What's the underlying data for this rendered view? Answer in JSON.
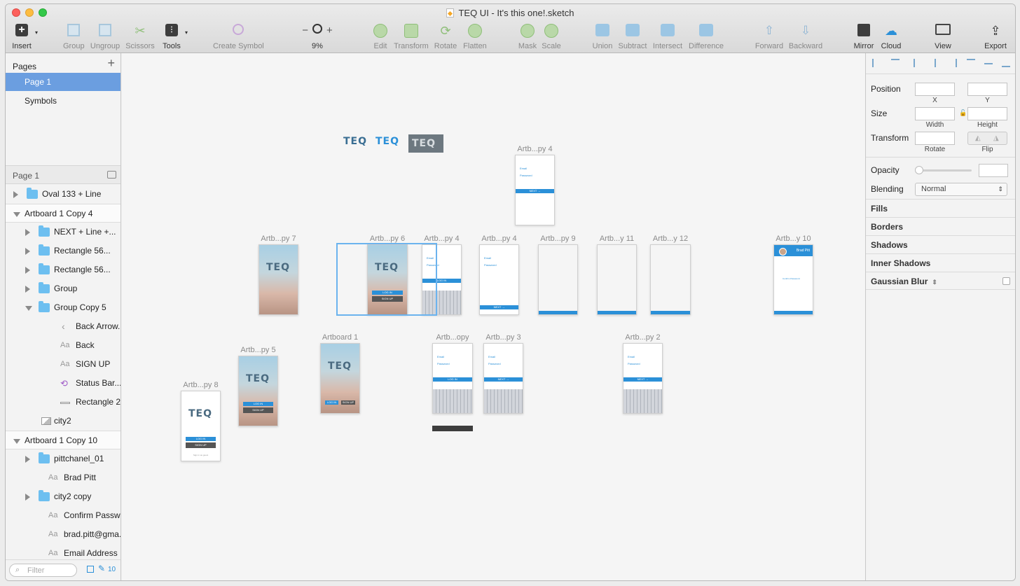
{
  "window": {
    "title": "TEQ UI - It's this one!.sketch"
  },
  "toolbar": {
    "insert": "Insert",
    "group": "Group",
    "ungroup": "Ungroup",
    "scissors": "Scissors",
    "tools": "Tools",
    "create_symbol": "Create Symbol",
    "zoom": "9%",
    "zoom_minus": "−",
    "zoom_plus": "+",
    "edit": "Edit",
    "transform": "Transform",
    "rotate": "Rotate",
    "flatten": "Flatten",
    "mask": "Mask",
    "scale": "Scale",
    "union": "Union",
    "subtract": "Subtract",
    "intersect": "Intersect",
    "difference": "Difference",
    "forward": "Forward",
    "backward": "Backward",
    "mirror": "Mirror",
    "cloud": "Cloud",
    "view": "View",
    "export": "Export"
  },
  "pages": {
    "header": "Pages",
    "add": "+",
    "items": [
      "Page 1",
      "Symbols"
    ],
    "selected": "Page 1"
  },
  "layers": {
    "page_header": "Page 1",
    "items": [
      {
        "name": "Oval 133 + Line",
        "type": "folder",
        "indent": 0,
        "collapsed": true
      },
      {
        "name": "Artboard 1 Copy 4",
        "type": "artboard",
        "indent": 0
      },
      {
        "name": "NEXT + Line +...",
        "type": "folder",
        "indent": 1,
        "collapsed": true
      },
      {
        "name": "Rectangle 56...",
        "type": "folder",
        "indent": 1,
        "collapsed": true
      },
      {
        "name": "Rectangle 56...",
        "type": "folder",
        "indent": 1,
        "collapsed": true
      },
      {
        "name": "Group",
        "type": "folder",
        "indent": 1,
        "collapsed": true
      },
      {
        "name": "Group Copy 5",
        "type": "folder",
        "indent": 1,
        "collapsed": false
      },
      {
        "name": "Back Arrow...",
        "type": "shape",
        "indent": 2
      },
      {
        "name": "Back",
        "type": "text",
        "indent": 2
      },
      {
        "name": "SIGN UP",
        "type": "text",
        "indent": 2
      },
      {
        "name": "Status Bar...",
        "type": "symbol",
        "indent": 2
      },
      {
        "name": "Rectangle 2...",
        "type": "rect",
        "indent": 2
      },
      {
        "name": "city2",
        "type": "image",
        "indent": 1
      },
      {
        "name": "Artboard 1 Copy 10",
        "type": "artboard",
        "indent": 0
      },
      {
        "name": "pittchanel_01",
        "type": "folder",
        "indent": 1,
        "collapsed": true
      },
      {
        "name": "Brad Pitt",
        "type": "text",
        "indent": 1
      },
      {
        "name": "city2 copy",
        "type": "folder",
        "indent": 1,
        "collapsed": true
      },
      {
        "name": "Confirm Passw...",
        "type": "text",
        "indent": 1
      },
      {
        "name": "brad.pitt@gma...",
        "type": "text",
        "indent": 1
      },
      {
        "name": "Email Address",
        "type": "text",
        "indent": 1
      }
    ],
    "filter_placeholder": "Filter",
    "count": "10"
  },
  "canvas": {
    "artboards": [
      {
        "label": "Artb...py 4",
        "kind": "signup-top"
      },
      {
        "label": "Artb...py 7",
        "kind": "city"
      },
      {
        "label": "Artb...py 6",
        "kind": "city-login"
      },
      {
        "label": "Artb...py 4",
        "kind": "login-kbd"
      },
      {
        "label": "Artb...py 4",
        "kind": "form"
      },
      {
        "label": "Artb...py 9",
        "kind": "map"
      },
      {
        "label": "Artb...y 11",
        "kind": "map"
      },
      {
        "label": "Artb...y 12",
        "kind": "map"
      },
      {
        "label": "Artb...y 10",
        "kind": "profile"
      },
      {
        "label": "Artboard 1",
        "kind": "city"
      },
      {
        "label": "Artb...opy",
        "kind": "login-kbd"
      },
      {
        "label": "Artb...py 3",
        "kind": "login-kbd"
      },
      {
        "label": "Artb...py 2",
        "kind": "login-kbd"
      },
      {
        "label": "Artb...py 5",
        "kind": "city-login"
      },
      {
        "label": "Artb...py 8",
        "kind": "white-login"
      }
    ],
    "logo_text": "TEQ",
    "screen_text": {
      "login": "LOG IN",
      "signup": "SIGN UP",
      "next": "NEXT →",
      "brad": "Brad Pitt",
      "full_name": "Full Name",
      "last_name": "Last Name",
      "email": "Email",
      "password": "Password",
      "confirm": "Confirm Password",
      "fine": "Sign in as guest"
    }
  },
  "inspector": {
    "position": "Position",
    "x": "X",
    "y": "Y",
    "size": "Size",
    "width": "Width",
    "height": "Height",
    "transform": "Transform",
    "rotate": "Rotate",
    "flip": "Flip",
    "opacity": "Opacity",
    "blending": "Blending",
    "blending_value": "Normal",
    "fills": "Fills",
    "borders": "Borders",
    "shadows": "Shadows",
    "inner_shadows": "Inner Shadows",
    "gaussian_blur": "Gaussian Blur"
  }
}
